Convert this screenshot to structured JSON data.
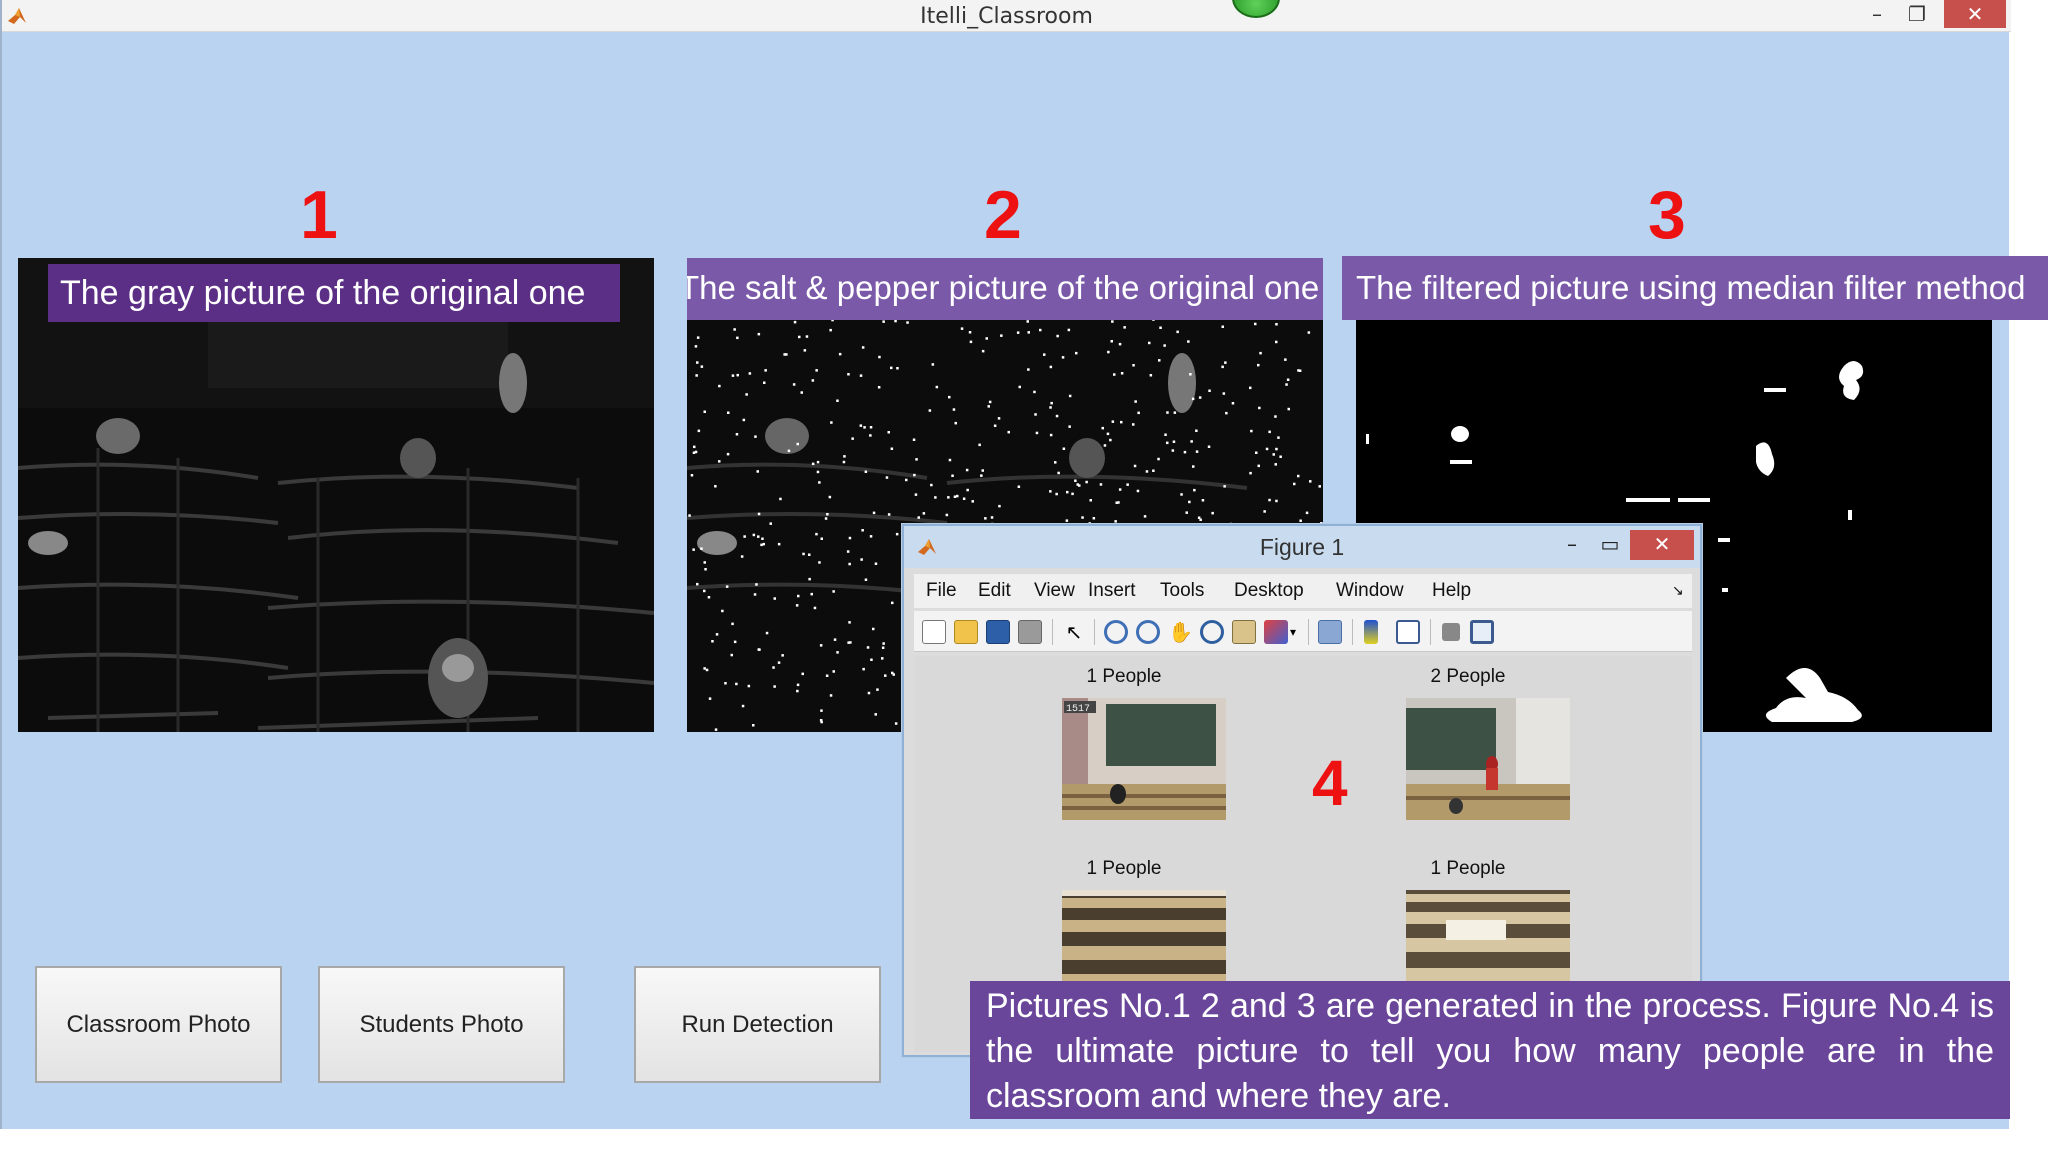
{
  "window": {
    "title": "Itelli_Classroom",
    "controls": {
      "minimize": "–",
      "restore": "❐",
      "close": "✕"
    }
  },
  "panels": [
    {
      "number": "1",
      "caption": "The gray picture of the original one"
    },
    {
      "number": "2",
      "caption": "The salt & pepper picture of the original one"
    },
    {
      "number": "3",
      "caption": "The filtered picture using median filter method"
    }
  ],
  "buttons": {
    "classroom_photo": "Classroom Photo",
    "students_photo": "Students Photo",
    "run_detection": "Run Detection"
  },
  "figure": {
    "title": "Figure 1",
    "number": "4",
    "menu": [
      "File",
      "Edit",
      "View",
      "Insert",
      "Tools",
      "Desktop",
      "Window",
      "Help"
    ],
    "toolbar_icons": [
      "new-figure-icon",
      "open-file-icon",
      "save-icon",
      "print-icon",
      "select-arrow-icon",
      "zoom-in-icon",
      "zoom-out-icon",
      "pan-hand-icon",
      "rotate-3d-icon",
      "data-cursor-icon",
      "brush-icon",
      "link-plot-icon",
      "colorbar-icon",
      "legend-icon",
      "hide-plot-tools-icon",
      "show-plot-tools-icon"
    ],
    "subplots": [
      {
        "title": "1 People",
        "stamp": "1517"
      },
      {
        "title": "2 People",
        "stamp": ""
      },
      {
        "title": "1 People",
        "stamp": ""
      },
      {
        "title": "1 People",
        "stamp": ""
      }
    ]
  },
  "note": "Pictures No.1 2 and 3 are generated in the process. Figure No.4 is the ultimate picture to tell you how many people are in the classroom and where they are.",
  "colors": {
    "window_bg": "#b9d3f0",
    "caption_bg": "#5b2f86",
    "number_red": "#ee1111",
    "close_red": "#c7504c"
  }
}
